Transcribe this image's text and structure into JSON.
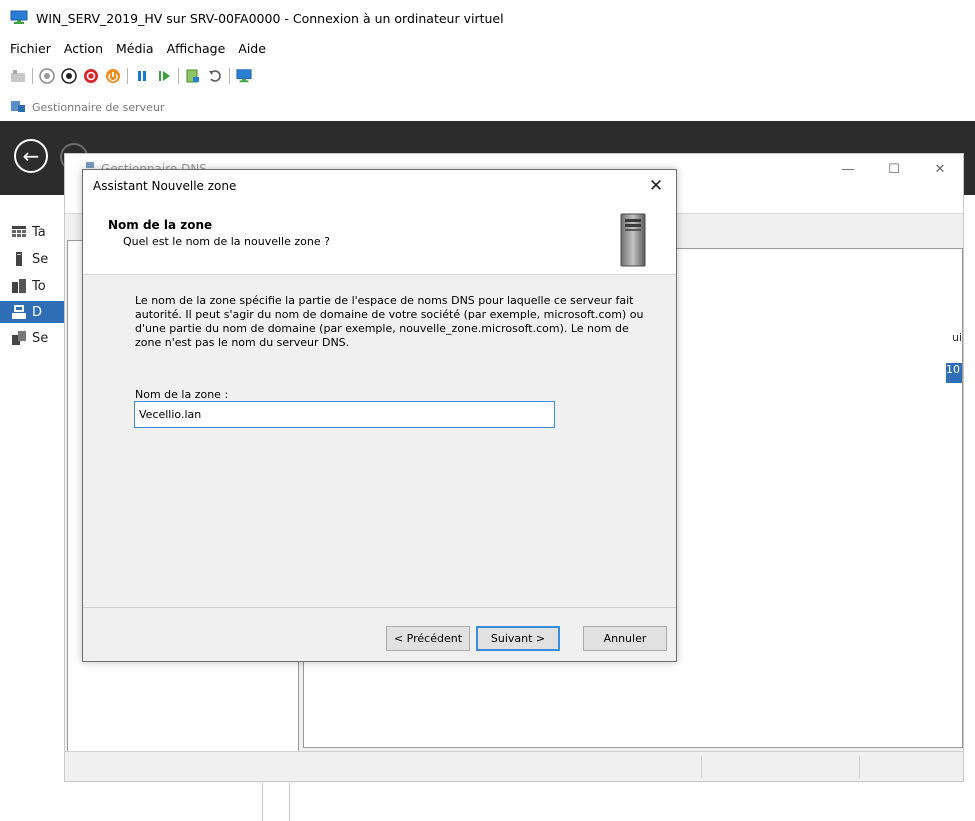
{
  "vm": {
    "title": "WIN_SERV_2019_HV sur SRV-00FA0000 - Connexion à un ordinateur virtuel",
    "menu": [
      "Fichier",
      "Action",
      "Média",
      "Affichage",
      "Aide"
    ],
    "tab_label": "Gestionnaire de serveur"
  },
  "server_manager": {
    "nav_items": [
      {
        "label": "Ta",
        "icon": "dashboard-icon"
      },
      {
        "label": "Se",
        "icon": "local-server-icon"
      },
      {
        "label": "To",
        "icon": "all-servers-icon"
      },
      {
        "label": "D",
        "icon": "dns-icon",
        "active": true
      },
      {
        "label": "Se",
        "icon": "file-services-icon"
      }
    ]
  },
  "dns_manager": {
    "title": "Gestionnaire DNS",
    "detail_col_fragment": "ui",
    "detail_sel_fragment": "10"
  },
  "wizard": {
    "title": "Assistant Nouvelle zone",
    "header_title": "Nom de la zone",
    "header_subtitle": "Quel est le nom de la nouvelle zone ?",
    "description": "Le nom de la zone spécifie la partie de l'espace de noms DNS pour laquelle ce serveur fait autorité. Il peut s'agir du nom de domaine de votre société (par exemple, microsoft.com) ou d'une partie du nom de domaine (par exemple, nouvelle_zone.microsoft.com). Le nom de zone n'est pas le nom du serveur DNS.",
    "field_label": "Nom de la zone :",
    "field_value": "Vecellio.lan",
    "buttons": {
      "back": "< Précédent",
      "next": "Suivant >",
      "cancel": "Annuler"
    }
  },
  "colors": {
    "accent": "#3c8cdc",
    "selection": "#2f6db5",
    "header_dark": "#2c2c2c"
  }
}
